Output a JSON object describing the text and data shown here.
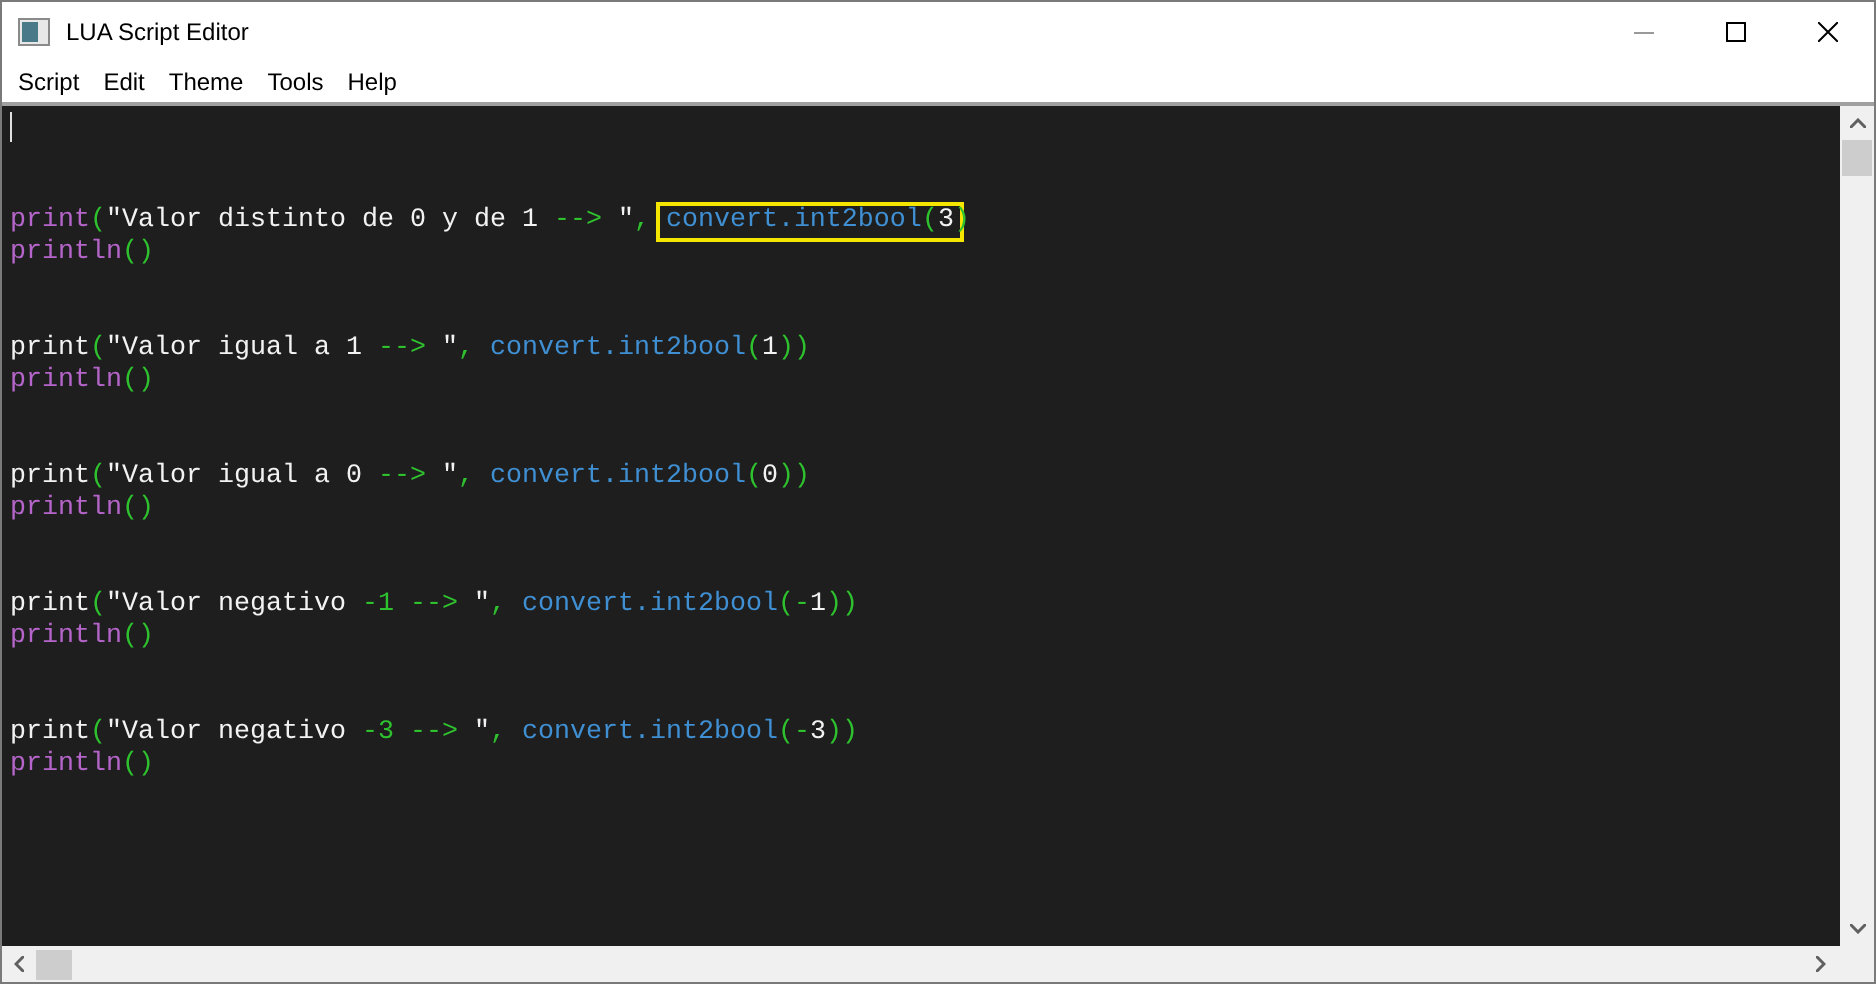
{
  "window": {
    "title": "LUA Script Editor"
  },
  "menu": [
    "Script",
    "Edit",
    "Theme",
    "Tools",
    "Help"
  ],
  "lines": [
    {
      "kind": "blank",
      "cursor": true
    },
    {
      "kind": "blank",
      "cursor": false
    },
    {
      "kind": "blank",
      "cursor": false
    },
    {
      "kind": "code",
      "cursor": false,
      "tokens": [
        {
          "kind": "keyword",
          "text": "print"
        },
        {
          "kind": "punct",
          "text": "("
        },
        {
          "kind": "plain",
          "text": "\"Valor distinto de 0 y de 1 "
        },
        {
          "kind": "punct",
          "text": "-->"
        },
        {
          "kind": "plain",
          "text": " \""
        },
        {
          "kind": "punct",
          "text": ", "
        },
        {
          "kind": "highlight",
          "tokens": [
            {
              "kind": "function",
              "text": "convert.int2bool"
            },
            {
              "kind": "punct",
              "text": "("
            },
            {
              "kind": "plain",
              "text": "3"
            }
          ]
        },
        {
          "kind": "punct",
          "text": ")"
        }
      ]
    },
    {
      "kind": "code",
      "cursor": false,
      "tokens": [
        {
          "kind": "keyword",
          "text": "println"
        },
        {
          "kind": "punct",
          "text": "()"
        }
      ]
    },
    {
      "kind": "blank",
      "cursor": false
    },
    {
      "kind": "blank",
      "cursor": false
    },
    {
      "kind": "code",
      "cursor": false,
      "tokens": [
        {
          "kind": "plain",
          "text": "print"
        },
        {
          "kind": "punct",
          "text": "("
        },
        {
          "kind": "plain",
          "text": "\"Valor igual a 1 "
        },
        {
          "kind": "punct",
          "text": "-->"
        },
        {
          "kind": "plain",
          "text": " \""
        },
        {
          "kind": "punct",
          "text": ", "
        },
        {
          "kind": "function",
          "text": "convert.int2bool"
        },
        {
          "kind": "punct",
          "text": "("
        },
        {
          "kind": "plain",
          "text": "1"
        },
        {
          "kind": "punct",
          "text": "))"
        }
      ]
    },
    {
      "kind": "code",
      "cursor": false,
      "tokens": [
        {
          "kind": "keyword",
          "text": "println"
        },
        {
          "kind": "punct",
          "text": "()"
        }
      ]
    },
    {
      "kind": "blank",
      "cursor": false
    },
    {
      "kind": "blank",
      "cursor": false
    },
    {
      "kind": "code",
      "cursor": false,
      "tokens": [
        {
          "kind": "plain",
          "text": "print"
        },
        {
          "kind": "punct",
          "text": "("
        },
        {
          "kind": "plain",
          "text": "\"Valor igual a 0 "
        },
        {
          "kind": "punct",
          "text": "-->"
        },
        {
          "kind": "plain",
          "text": " \""
        },
        {
          "kind": "punct",
          "text": ", "
        },
        {
          "kind": "function",
          "text": "convert.int2bool"
        },
        {
          "kind": "punct",
          "text": "("
        },
        {
          "kind": "plain",
          "text": "0"
        },
        {
          "kind": "punct",
          "text": "))"
        }
      ]
    },
    {
      "kind": "code",
      "cursor": false,
      "tokens": [
        {
          "kind": "keyword",
          "text": "println"
        },
        {
          "kind": "punct",
          "text": "()"
        }
      ]
    },
    {
      "kind": "blank",
      "cursor": false
    },
    {
      "kind": "blank",
      "cursor": false
    },
    {
      "kind": "code",
      "cursor": false,
      "tokens": [
        {
          "kind": "plain",
          "text": "print"
        },
        {
          "kind": "punct",
          "text": "("
        },
        {
          "kind": "plain",
          "text": "\"Valor negativo "
        },
        {
          "kind": "punct",
          "text": "-1 -->"
        },
        {
          "kind": "plain",
          "text": " \""
        },
        {
          "kind": "punct",
          "text": ", "
        },
        {
          "kind": "function",
          "text": "convert.int2bool"
        },
        {
          "kind": "punct",
          "text": "(-"
        },
        {
          "kind": "plain",
          "text": "1"
        },
        {
          "kind": "punct",
          "text": "))"
        }
      ]
    },
    {
      "kind": "code",
      "cursor": false,
      "tokens": [
        {
          "kind": "keyword",
          "text": "println"
        },
        {
          "kind": "punct",
          "text": "()"
        }
      ]
    },
    {
      "kind": "blank",
      "cursor": false
    },
    {
      "kind": "blank",
      "cursor": false
    },
    {
      "kind": "code",
      "cursor": false,
      "tokens": [
        {
          "kind": "plain",
          "text": "print"
        },
        {
          "kind": "punct",
          "text": "("
        },
        {
          "kind": "plain",
          "text": "\"Valor negativo "
        },
        {
          "kind": "punct",
          "text": "-3 -->"
        },
        {
          "kind": "plain",
          "text": " \""
        },
        {
          "kind": "punct",
          "text": ", "
        },
        {
          "kind": "function",
          "text": "convert.int2bool"
        },
        {
          "kind": "punct",
          "text": "(-"
        },
        {
          "kind": "plain",
          "text": "3"
        },
        {
          "kind": "punct",
          "text": "))"
        }
      ]
    },
    {
      "kind": "code",
      "cursor": false,
      "tokens": [
        {
          "kind": "keyword",
          "text": "println"
        },
        {
          "kind": "punct",
          "text": "()"
        }
      ]
    }
  ]
}
